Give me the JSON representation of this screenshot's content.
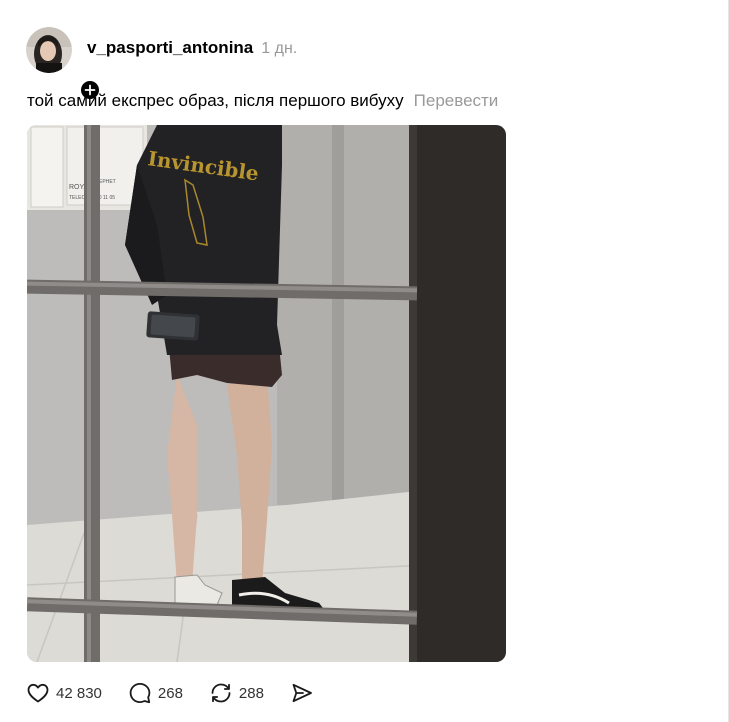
{
  "post": {
    "username": "v_pasporti_antonina",
    "timestamp": "1 дн.",
    "caption": "той самий експрес образ, після першого вибуху",
    "translate_label": "Перевести",
    "photo_texts": {
      "jacket_print": "Invincible",
      "sign_line_1": "ROYA",
      "sign_line_2": "ІНТЕРНЕТ",
      "sign_line_3": "TELEC",
      "sign_line_4": "4 300 11 05"
    }
  },
  "actions": {
    "likes": "42 830",
    "comments": "268",
    "reposts": "288"
  },
  "icons": {
    "avatar": "avatar",
    "follow": "plus-icon",
    "like": "heart-icon",
    "comment": "comment-bubble-icon",
    "repost": "repost-icon",
    "share": "send-icon"
  },
  "colors": {
    "text": "#000000",
    "muted": "#999999",
    "count": "#333333"
  }
}
